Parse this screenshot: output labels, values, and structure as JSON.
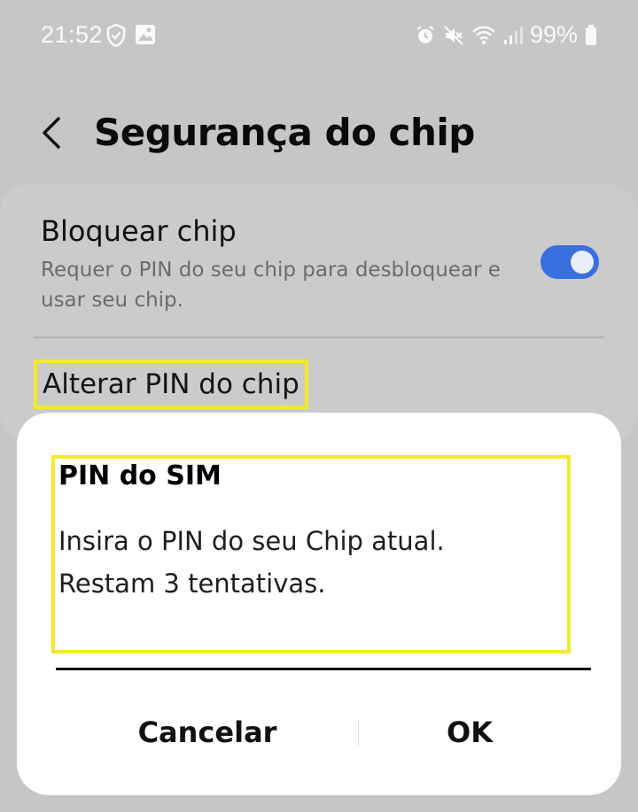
{
  "status_bar": {
    "time": "21:52",
    "battery": "99%",
    "left_icons": [
      "shield-icon",
      "gallery-icon"
    ],
    "right_icons": [
      "alarm-icon",
      "mute-icon",
      "wifi-icon",
      "signal-icon",
      "battery-icon"
    ]
  },
  "header": {
    "title": "Segurança do chip"
  },
  "settings": {
    "lock_chip": {
      "title": "Bloquear chip",
      "subtitle": "Requer o PIN do seu chip para desbloquear e usar seu chip.",
      "toggle_on": true
    },
    "change_pin": "Alterar PIN do chip"
  },
  "dialog": {
    "title": "PIN do SIM",
    "message_line1": "Insira o PIN do seu Chip atual.",
    "message_line2": "Restam 3 tentativas.",
    "cancel_label": "Cancelar",
    "ok_label": "OK"
  },
  "colors": {
    "background": "#c6c6c6",
    "accent": "#3a6fe0",
    "highlight": "#f2ea2c",
    "dialog": "#ffffff"
  }
}
